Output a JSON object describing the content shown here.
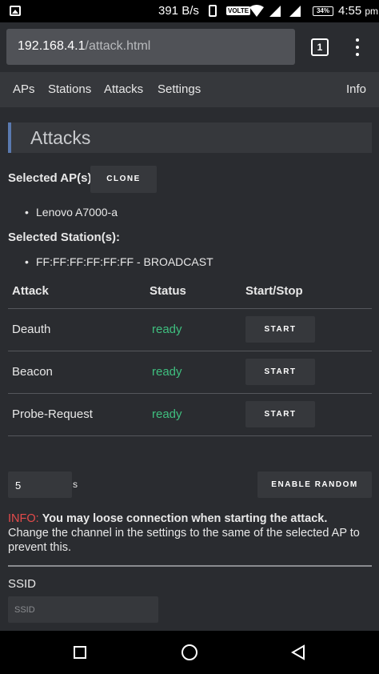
{
  "statusbar": {
    "speed": "391 B/s",
    "volte": "VOLTE",
    "battery": "34%",
    "time": "4:55",
    "ampm": "pm"
  },
  "browser": {
    "url_host": "192.168.4.1",
    "url_path": "/attack.html",
    "tab_count": "1"
  },
  "nav": {
    "items": [
      {
        "label": "APs"
      },
      {
        "label": "Stations"
      },
      {
        "label": "Attacks"
      },
      {
        "label": "Settings"
      },
      {
        "label": "Info"
      }
    ]
  },
  "page": {
    "title": "Attacks",
    "selected_ap_label": "Selected AP(s):",
    "clone_label": "CLONE",
    "selected_ap": "Lenovo A7000-a",
    "selected_station_label": "Selected Station(s):",
    "selected_station": "FF:FF:FF:FF:FF:FF - BROADCAST"
  },
  "table": {
    "headers": [
      "Attack",
      "Status",
      "Start/Stop"
    ],
    "rows": [
      {
        "attack": "Deauth",
        "status": "ready",
        "action": "START"
      },
      {
        "attack": "Beacon",
        "status": "ready",
        "action": "START"
      },
      {
        "attack": "Probe-Request",
        "status": "ready",
        "action": "START"
      }
    ]
  },
  "random": {
    "interval_value": "5",
    "unit": "s",
    "button_label": "ENABLE RANDOM"
  },
  "info": {
    "tag": "INFO:",
    "bold_text": "You may loose connection when starting the attack.",
    "text": "Change the channel in the settings to the same of the selected AP to prevent this."
  },
  "ssid": {
    "label": "SSID",
    "placeholder": "SSID"
  },
  "colors": {
    "accent": "#5a7ab0",
    "status_ready": "#3fbf7f",
    "info_tag": "#e54b4b"
  }
}
